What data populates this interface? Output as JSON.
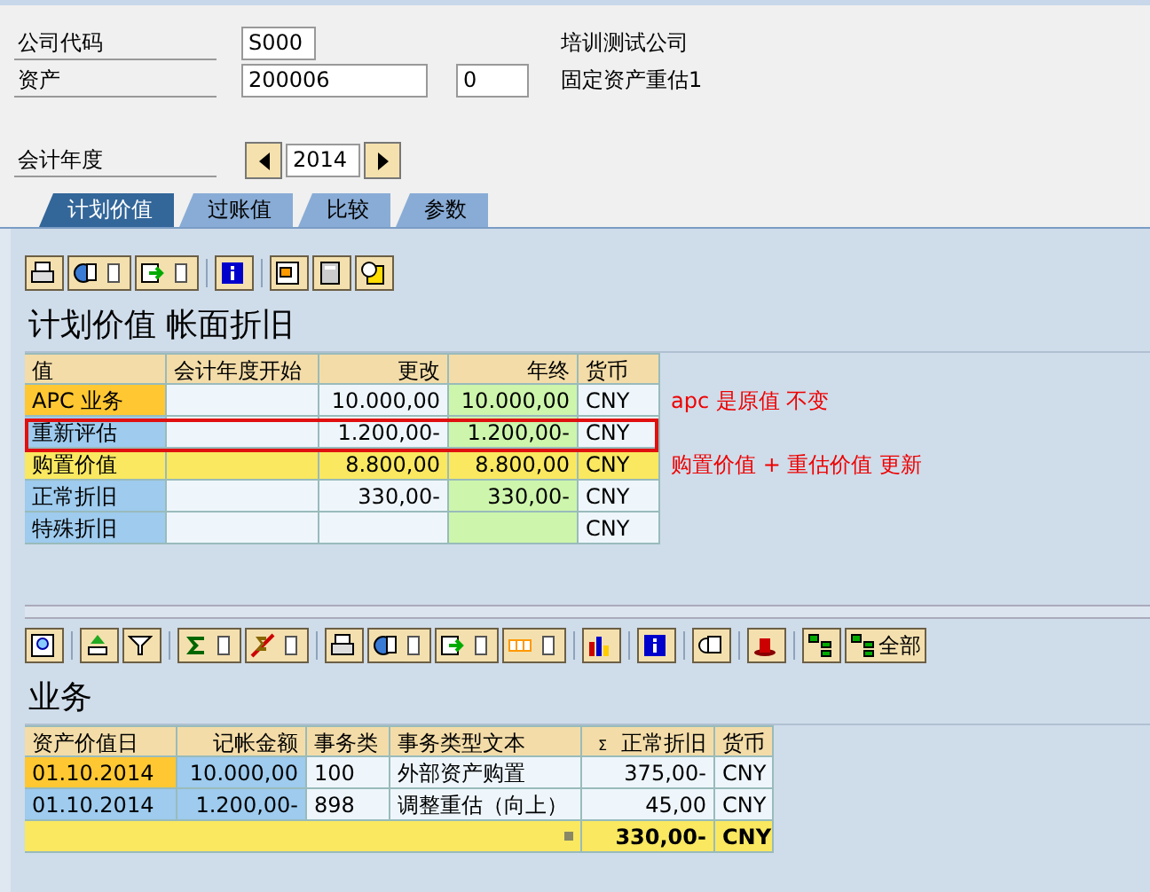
{
  "header": {
    "company_code_label": "公司代码",
    "company_code": "S000",
    "company_name": "培训测试公司",
    "asset_label": "资产",
    "asset_number": "200006",
    "sub_number": "0",
    "asset_description": "固定资产重估1",
    "fiscal_year_label": "会计年度",
    "fiscal_year": "2014"
  },
  "tabs": [
    {
      "label": "计划价值",
      "selected": true
    },
    {
      "label": "过账值",
      "selected": false
    },
    {
      "label": "比较",
      "selected": false
    },
    {
      "label": "参数",
      "selected": false
    }
  ],
  "values_table": {
    "title": "计划价值 帐面折旧",
    "columns": [
      "值",
      "会计年度开始",
      "更改",
      "年终",
      "货币"
    ],
    "rows": [
      {
        "kind": "focused",
        "cells": [
          "APC 业务",
          null,
          "10.000,00",
          "10.000,00",
          "CNY"
        ],
        "note": "apc 是原值 不变"
      },
      {
        "kind": "framed",
        "cells": [
          "重新评估",
          null,
          "1.200,00-",
          "1.200,00-",
          "CNY"
        ]
      },
      {
        "kind": "total",
        "cells": [
          "购置价值",
          null,
          "8.800,00",
          "8.800,00",
          "CNY"
        ],
        "note": "购置价值 + 重估价值 更新"
      },
      {
        "kind": "plain",
        "cells": [
          "正常折旧",
          null,
          "330,00-",
          "330,00-",
          "CNY"
        ]
      },
      {
        "kind": "plain",
        "cells": [
          "特殊折旧",
          null,
          null,
          null,
          "CNY"
        ]
      }
    ]
  },
  "transactions": {
    "title": "业务",
    "all_button": "全部",
    "columns": [
      "资产价值日",
      "记帐金额",
      "事务类",
      "事务类型文本",
      "正常折旧",
      "货币"
    ],
    "sum_mark": "Σ",
    "rows": [
      {
        "kind": "focused",
        "cells": [
          "01.10.2014",
          "10.000,00",
          "100",
          "外部资产购置",
          "375,00-",
          "CNY"
        ]
      },
      {
        "kind": "plain",
        "cells": [
          "01.10.2014",
          "1.200,00-",
          "898",
          "调整重估（向上）",
          "45,00",
          "CNY"
        ]
      }
    ],
    "total": {
      "amount": "330,00-",
      "currency": "CNY"
    }
  }
}
